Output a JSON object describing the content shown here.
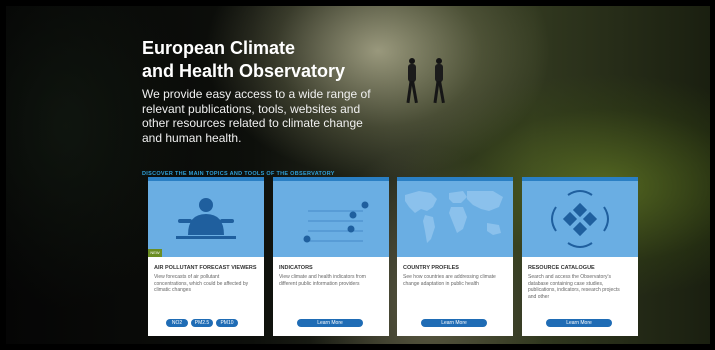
{
  "hero": {
    "title_line1": "European Climate",
    "title_line2": "and Health Observatory",
    "intro": "We provide easy access to a wide range of relevant publications, tools, websites and other resources related to climate change and human health."
  },
  "discover_label": "DISCOVER THE MAIN TOPICS AND TOOLS OF THE OBSERVATORY",
  "cards": [
    {
      "badge": "NEW",
      "title": "AIR POLLUTANT FORECAST VIEWERS",
      "desc": "View forecasts of air pollutant concentrations, which could be affected by climatic changes",
      "buttons": [
        "NO2",
        "PM2.5",
        "PM10"
      ]
    },
    {
      "title": "INDICATORS",
      "desc": "View climate and health indicators from different public information providers",
      "button": "Learn More"
    },
    {
      "title": "COUNTRY PROFILES",
      "desc": "See how countries are addressing climate change adaptation in public health",
      "button": "Learn More"
    },
    {
      "title": "RESOURCE CATALOGUE",
      "desc": "Search and access the Observatory's database containing case studies, publications, indicators, research projects and other",
      "button": "Learn More"
    }
  ],
  "colors": {
    "accent": "#2a7fc4",
    "illustration_bg": "#6aaee3",
    "discover_text": "#2f9fd8",
    "button": "#1f6cb5",
    "badge": "#6b8e23"
  }
}
